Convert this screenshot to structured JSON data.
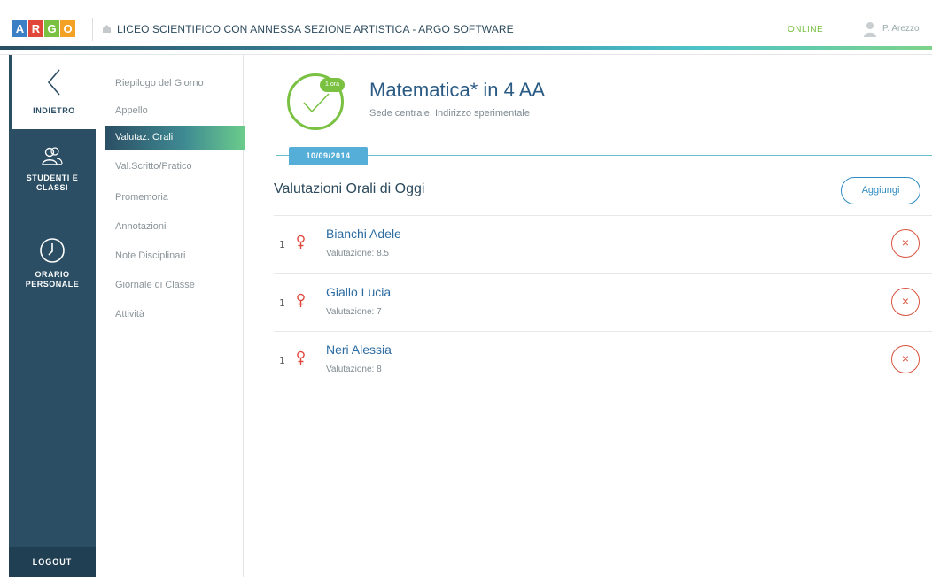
{
  "header": {
    "logo_letters": [
      {
        "char": "A",
        "color": "#3b7fc4"
      },
      {
        "char": "R",
        "color": "#e0463a"
      },
      {
        "char": "G",
        "color": "#7ac142"
      },
      {
        "char": "O",
        "color": "#f3a225"
      }
    ],
    "school_title": "LICEO SCIENTIFICO CON ANNESSA SEZIONE ARTISTICA - ARGO SOFTWARE",
    "status": "ONLINE",
    "user_name": "P. Arezzo"
  },
  "sidebar": {
    "back_label": "INDIETRO",
    "items": [
      {
        "label_line1": "STUDENTI E",
        "label_line2": "CLASSI",
        "icon": "users-icon"
      },
      {
        "label_line1": "ORARIO",
        "label_line2": "PERSONALE",
        "icon": "clock-icon"
      }
    ],
    "logout_label": "LOGOUT"
  },
  "submenu": {
    "items": [
      "Riepilogo del Giorno",
      "Appello",
      "Valutaz. Orali",
      "Val.Scritto/Pratico",
      "Promemoria",
      "Annotazioni",
      "Note Disciplinari",
      "Giornale di Classe",
      "Attività"
    ],
    "active_index": 2
  },
  "lesson": {
    "hours_badge": "1 ora",
    "title": "Matematica* in 4 AA",
    "subtitle": "Sede centrale, Indirizzo sperimentale",
    "date": "10/09/2014"
  },
  "grades": {
    "section_title": "Valutazioni Orali di Oggi",
    "add_label": "Aggiungi",
    "rows": [
      {
        "num": "1",
        "name": "Bianchi Adele",
        "grade": "Valutazione: 8.5"
      },
      {
        "num": "1",
        "name": "Giallo Lucia",
        "grade": "Valutazione: 7"
      },
      {
        "num": "1",
        "name": "Neri Alessia",
        "grade": "Valutazione: 8"
      }
    ]
  },
  "colors": {
    "sidebar": "#2b4e64",
    "accent_green": "#7ac142",
    "accent_blue": "#2e8bc0",
    "remove_red": "#d9533f",
    "gender_female": "#e0463a"
  }
}
